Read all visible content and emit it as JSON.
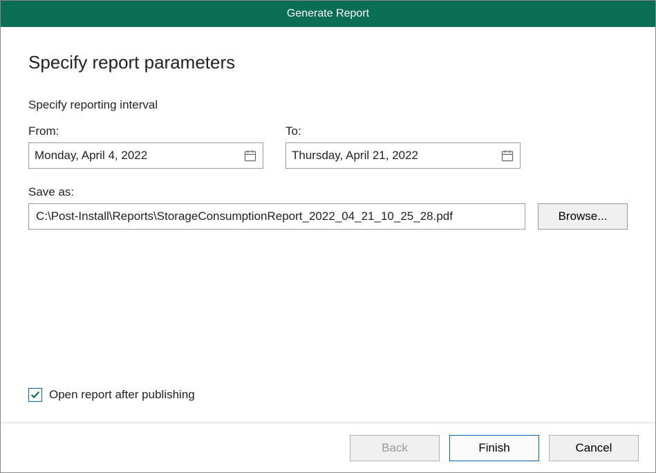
{
  "titlebar": {
    "title": "Generate Report"
  },
  "page": {
    "heading": "Specify report parameters",
    "interval_label": "Specify reporting interval"
  },
  "from": {
    "label": "From:",
    "value": "Monday, April 4, 2022"
  },
  "to": {
    "label": "To:",
    "value": "Thursday, April 21, 2022"
  },
  "save": {
    "label": "Save as:",
    "path": "C:\\Post-Install\\Reports\\StorageConsumptionReport_2022_04_21_10_25_28.pdf",
    "browse_label": "Browse..."
  },
  "open_after": {
    "label": "Open report after publishing",
    "checked": true
  },
  "footer": {
    "back": "Back",
    "finish": "Finish",
    "cancel": "Cancel"
  }
}
